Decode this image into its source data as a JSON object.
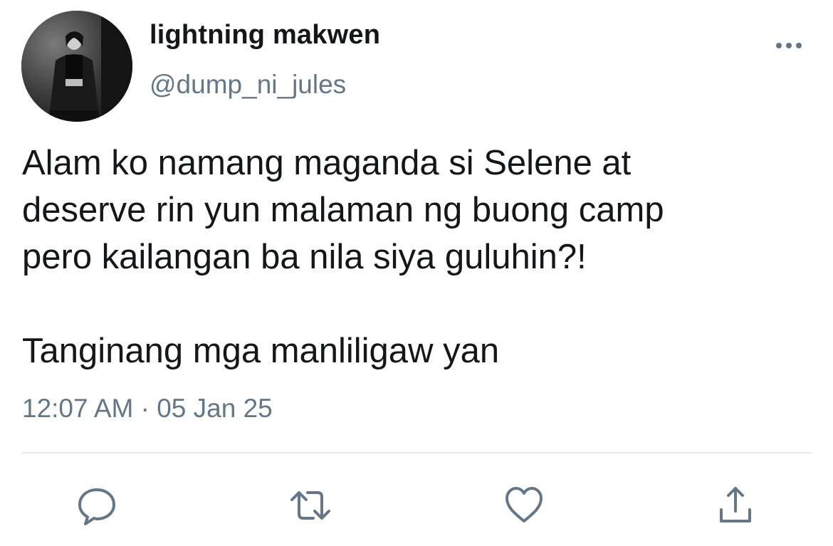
{
  "author": {
    "display_name": "lightning makwen",
    "handle": "@dump_ni_jules"
  },
  "tweet": {
    "text": "Alam ko namang maganda si Selene at\ndeserve rin yun malaman ng buong camp\npero kailangan ba nila siya guluhin?!\n\nTanginang mga manliligaw yan",
    "timestamp": "12:07 AM · 05 Jan 25"
  },
  "actions": {
    "reply_icon": "reply-icon",
    "retweet_icon": "retweet-icon",
    "like_icon": "heart-icon",
    "share_icon": "share-icon"
  },
  "colors": {
    "icon": "#657786",
    "text": "#14171a",
    "secondary": "#657786",
    "divider": "#e6ecf0"
  }
}
